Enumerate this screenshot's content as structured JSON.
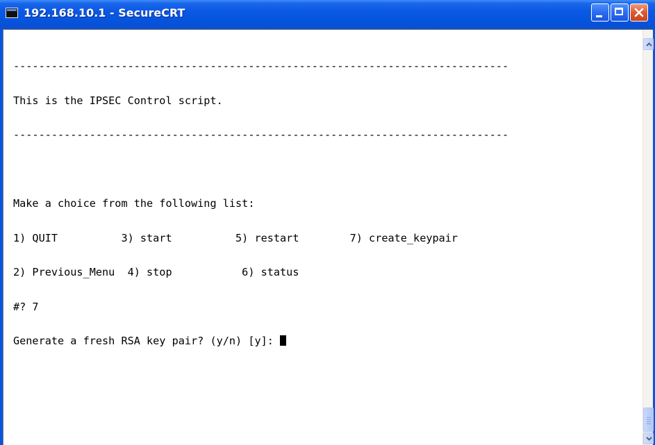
{
  "window": {
    "title": "192.168.10.1 - SecureCRT",
    "icon": "terminal-app-icon"
  },
  "terminal": {
    "lines": [
      "------------------------------------------------------------------------------",
      "This is the IPSEC Control script.",
      "------------------------------------------------------------------------------",
      "",
      "Make a choice from the following list:",
      "1) QUIT          3) start          5) restart        7) create_keypair",
      "2) Previous_Menu  4) stop           6) status",
      "#? 7",
      "Generate a fresh RSA key pair? (y/n) [y]: "
    ],
    "cursor_line": 8
  },
  "icons": {
    "minimize": "minimize-icon",
    "maximize": "maximize-icon",
    "close": "close-icon",
    "scroll_up": "arrow-up-icon",
    "scroll_down": "arrow-down-icon"
  },
  "colors": {
    "titlebar": "#0a58e4",
    "close_button": "#e0592e",
    "terminal_bg": "#ffffff",
    "terminal_fg": "#000000"
  }
}
